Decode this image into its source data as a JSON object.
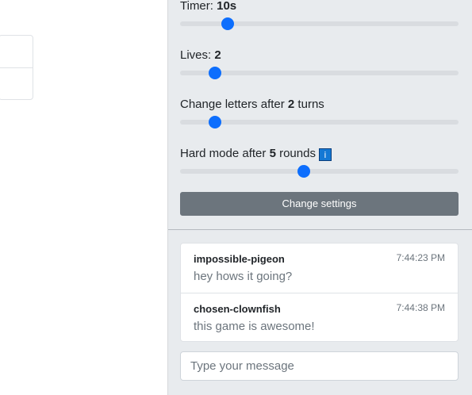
{
  "settings": {
    "timer": {
      "prefix": "Timer: ",
      "value": "10s",
      "slider_fraction": 0.17
    },
    "lives": {
      "prefix": "Lives: ",
      "value": "2",
      "slider_fraction": 0.125
    },
    "change_letters": {
      "prefix": "Change letters after ",
      "value": "2",
      "suffix": " turns",
      "slider_fraction": 0.125
    },
    "hard_mode": {
      "prefix": "Hard mode after ",
      "value": "5",
      "suffix": " rounds",
      "slider_fraction": 0.445,
      "info_icon": "info-icon"
    },
    "change_button_label": "Change settings"
  },
  "chat": {
    "messages": [
      {
        "user": "impossible-pigeon",
        "time": "7:44:23 PM",
        "text": "hey hows it going?"
      },
      {
        "user": "chosen-clownfish",
        "time": "7:44:38 PM",
        "text": "this game is awesome!"
      }
    ],
    "input_placeholder": "Type your message"
  },
  "colors": {
    "accent": "#0d6efd",
    "panel_bg": "#e8ebee",
    "button_bg": "#6c757d",
    "info_icon_bg": "#1478d4"
  }
}
